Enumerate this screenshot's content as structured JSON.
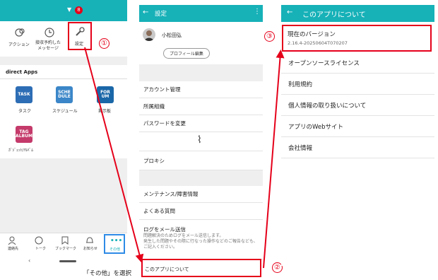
{
  "screen1": {
    "badge": "8",
    "apps_top": [
      {
        "label": "アクション",
        "icon": "action-icon"
      },
      {
        "label": "接収予約した\nメッセージ",
        "icon": "scheduled-message-icon"
      },
      {
        "label": "設定",
        "icon": "wrench-icon"
      }
    ],
    "section_title": "direct Apps",
    "apps": [
      {
        "tile": "TASK",
        "label": "タスク",
        "color": "#2d6db5"
      },
      {
        "tile": "SCHE\nDULE",
        "label": "スケジュール",
        "color": "#3b86c8"
      },
      {
        "tile": "FOR\nUM",
        "label": "掲示板",
        "color": "#1a67a8"
      },
      {
        "tile": "TAG\nALBUM",
        "label": "ｶﾞｼﾞｪｯﾄ/ｱﾙﾊﾞﾑ",
        "color": "#c43a6a"
      }
    ],
    "bottom_nav": [
      "連絡先",
      "トーク",
      "ブックマーク",
      "お知らせ",
      "その他"
    ],
    "caption": "「その他」を選択"
  },
  "screen2": {
    "title": "設定",
    "user_name": "小松田弘",
    "profile_button": "プロフィール編集",
    "items": [
      "アカウント管理",
      "所属組織",
      "パスワードを変更",
      "プロキシ",
      "メンテナンス/障害情報",
      "よくある質問"
    ],
    "log_title": "ログをメール送信",
    "log_desc": "問題解決のためログをメール送信します。\n発生した問題やその際に行なった操作などのご報告なども、ご記入ください。",
    "about": "このアプリについて"
  },
  "screen3": {
    "title": "このアプリについて",
    "version_label": "現在のバージョン",
    "version_value": "2.16.4-20250604T070207",
    "items": [
      "オープンソースライセンス",
      "利用規約",
      "個人情報の取り扱いについて",
      "アプリのWebサイト",
      "会社情報"
    ]
  },
  "markers": [
    "①",
    "②",
    "③"
  ],
  "colors": {
    "teal": "#17b1b8",
    "red": "#e5001a",
    "blue": "#2e8be6"
  }
}
